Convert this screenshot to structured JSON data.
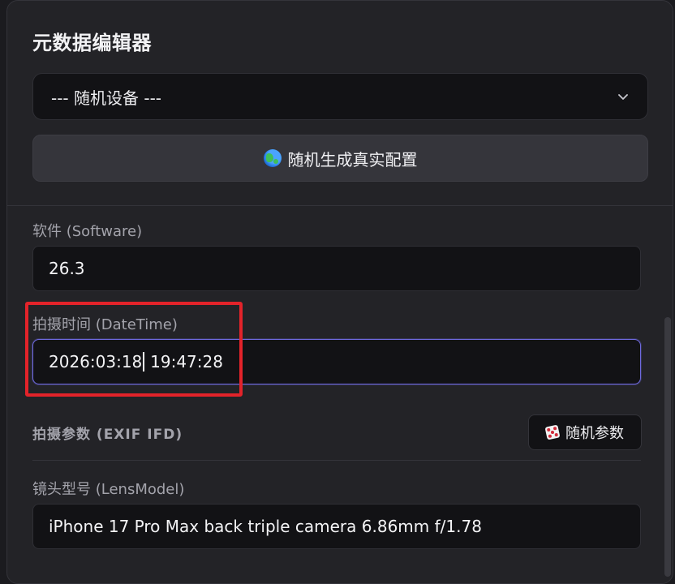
{
  "editor": {
    "title": "元数据编辑器",
    "device_select": {
      "selected": "--- 随机设备 ---",
      "chevron_icon": "chevron-down-icon"
    },
    "generate_button": {
      "icon": "globe-icon",
      "label": "随机生成真实配置"
    }
  },
  "fields": {
    "software": {
      "label": "软件 (Software)",
      "value": "26.3"
    },
    "datetime": {
      "label": "拍摄时间 (DateTime)",
      "value_before_caret": "2026:03:18",
      "value_after_caret": " 19:47:28"
    },
    "lens_model": {
      "label": "镜头型号 (LensModel)",
      "value": "iPhone 17 Pro Max back triple camera 6.86mm f/1.78"
    }
  },
  "exif_section": {
    "title": "拍摄参数 (EXIF IFD)",
    "random_button": {
      "icon": "dice-icon",
      "label": "随机参数"
    }
  },
  "colors": {
    "background": "#232327",
    "input_bg": "#121215",
    "focus_border": "#6f6ae0",
    "annotation_red": "#e3232a"
  }
}
